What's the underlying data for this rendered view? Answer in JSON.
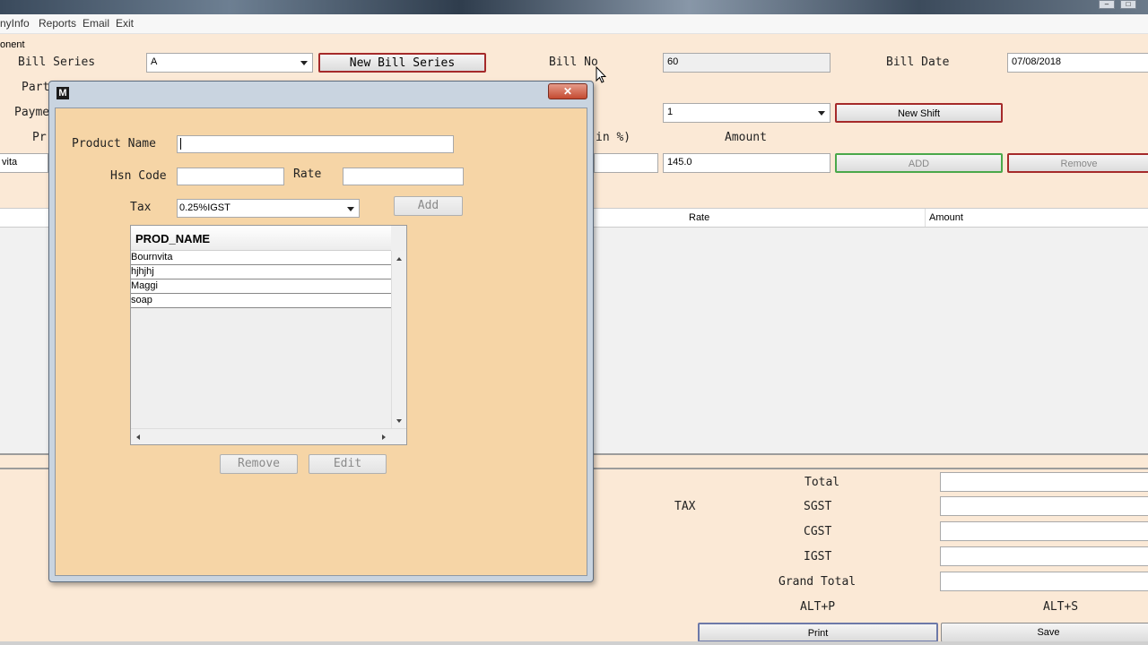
{
  "menu": {
    "items": [
      "nyInfo",
      "Reports",
      "Email",
      "Exit"
    ],
    "tab_fragment": "onent"
  },
  "form": {
    "bill_series_label": "Bill Series",
    "bill_series_value": "A",
    "new_bill_series": "New Bill Series",
    "bill_no_label": "Bill No",
    "bill_no_value": "60",
    "bill_date_label": "Bill Date",
    "bill_date_value": "07/08/2018",
    "party_label": "Part",
    "payment_label": "Payme",
    "product_label": "Pr",
    "shift_value": "1",
    "new_shift": "New Shift",
    "discount_label_fragment": "in %)",
    "amount_label": "Amount",
    "product_value_fragment": "vita",
    "amount_value": "145.0",
    "add_button": "ADD",
    "remove_button": "Remove"
  },
  "grid": {
    "col_rate": "Rate",
    "col_amount": "Amount"
  },
  "totals": {
    "total": "Total",
    "tax": "TAX",
    "sgst": "SGST",
    "cgst": "CGST",
    "igst": "IGST",
    "grand_total": "Grand Total",
    "alt_p": "ALT+P",
    "alt_s": "ALT+S",
    "print": "Print",
    "save": "Save"
  },
  "dialog": {
    "icon_letter": "M",
    "close_glyph": "✕",
    "product_name_label": "Product Name",
    "product_name_value": "",
    "hsn_label": "Hsn Code",
    "hsn_value": "",
    "rate_label": "Rate",
    "rate_value": "",
    "tax_label": "Tax",
    "tax_value": "0.25%IGST",
    "add_button": "Add",
    "table_header": "PROD_NAME",
    "products": [
      "Bournvita",
      "hjhjhj",
      "Maggi",
      "soap"
    ],
    "remove_button": "Remove",
    "edit_button": "Edit"
  }
}
